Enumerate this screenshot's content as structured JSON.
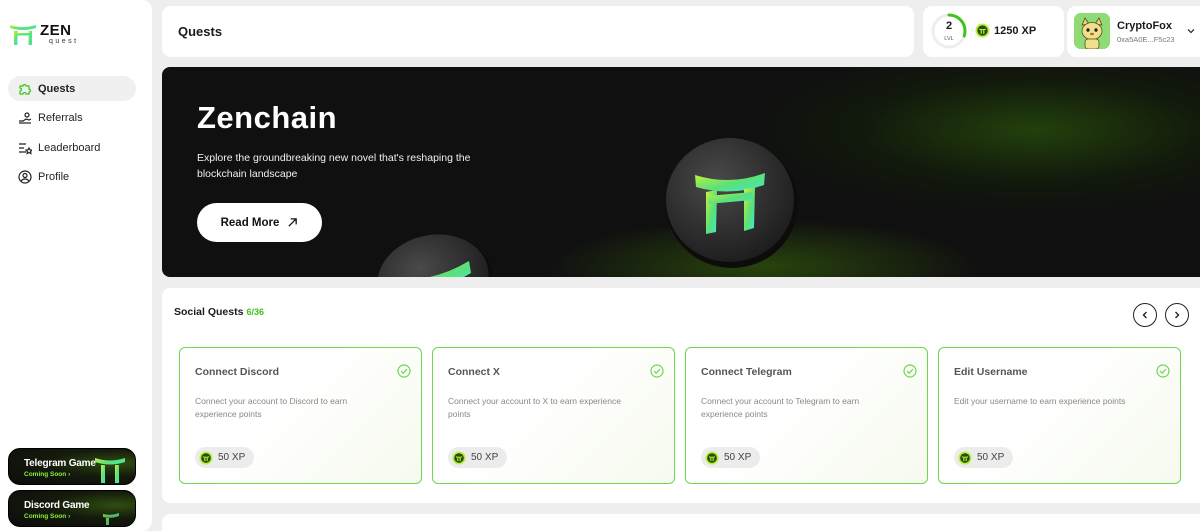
{
  "brand": {
    "name": "ZEN",
    "sub": "quest"
  },
  "nav": [
    {
      "label": "Quests",
      "icon": "puzzle-icon",
      "active": true
    },
    {
      "label": "Referrals",
      "icon": "referrals-icon",
      "active": false
    },
    {
      "label": "Leaderboard",
      "icon": "leaderboard-icon",
      "active": false
    },
    {
      "label": "Profile",
      "icon": "profile-icon",
      "active": false
    }
  ],
  "games": [
    {
      "title": "Telegram Game",
      "status": "Coming Soon"
    },
    {
      "title": "Discord Game",
      "status": "Coming Soon"
    }
  ],
  "header": {
    "title": "Quests"
  },
  "level": {
    "value": "2",
    "label": "LVL",
    "progress": 0.3
  },
  "xp": {
    "amount": "1250 XP"
  },
  "user": {
    "name": "CryptoFox",
    "address": "0xa5A0E...F5c23"
  },
  "hero": {
    "title": "Zenchain",
    "description": "Explore the groundbreaking new novel that's reshaping the blockchain landscape",
    "button": "Read More"
  },
  "social_quests": {
    "title": "Social Quests",
    "count": "6/36",
    "cards": [
      {
        "title": "Connect Discord",
        "description": "Connect your account to Discord to earn experience points",
        "reward": "50 XP"
      },
      {
        "title": "Connect X",
        "description": "Connect your account to X to earn experience points",
        "reward": "50 XP"
      },
      {
        "title": "Connect Telegram",
        "description": "Connect your account to Telegram to earn experience points",
        "reward": "50 XP"
      },
      {
        "title": "Edit Username",
        "description": "Edit your username to earn experience points",
        "reward": "50 XP"
      }
    ]
  },
  "colors": {
    "accent": "#3ec31b",
    "card_border": "#6fd64e",
    "hero_bg": "#101010",
    "coin_green": "#8ef02a",
    "coin_cyan": "#3fe8c8"
  }
}
